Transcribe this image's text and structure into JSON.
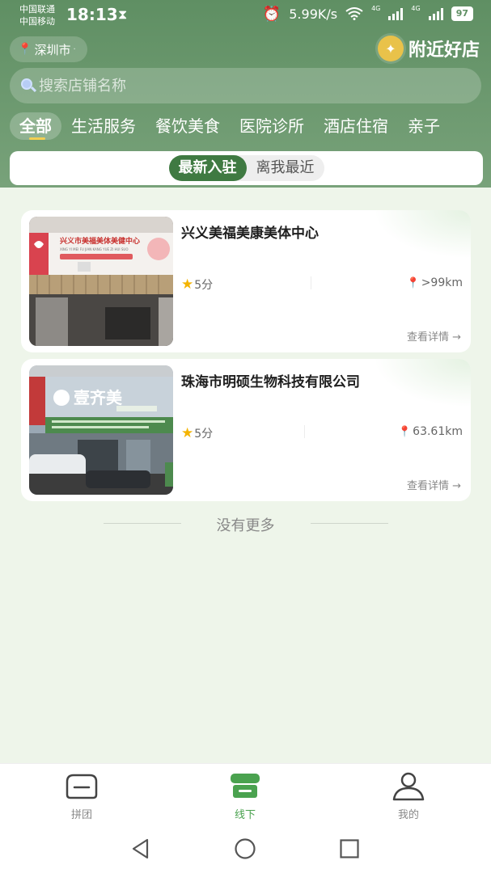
{
  "status_bar": {
    "carrier_1": "中国联通",
    "carrier_2": "中国移动",
    "time": "18:13",
    "speed": "5.99K/s",
    "network_1": "4G",
    "network_2": "4G",
    "battery": "97"
  },
  "header": {
    "location": "深圳市",
    "title": "附近好店",
    "search_placeholder": "搜索店铺名称"
  },
  "category_tabs": [
    {
      "label": "全部",
      "active": true
    },
    {
      "label": "生活服务",
      "active": false
    },
    {
      "label": "餐饮美食",
      "active": false
    },
    {
      "label": "医院诊所",
      "active": false
    },
    {
      "label": "酒店住宿",
      "active": false
    },
    {
      "label": "亲子",
      "active": false
    }
  ],
  "sort": {
    "newest": "最新入驻",
    "nearest": "离我最近",
    "active": "newest"
  },
  "stores": [
    {
      "name": "兴义美福美康美体中心",
      "rating": "5分",
      "distance": ">99km",
      "detail": "查看详情 →",
      "sign_text": "兴义市美福美体美健中心",
      "sign_sub": "XING YI MEI FU JIAN KANG YUE ZI HUI SUO"
    },
    {
      "name": "珠海市明硕生物科技有限公司",
      "rating": "5分",
      "distance": "63.61km",
      "detail": "查看详情 →",
      "sign_text": "壹齐美"
    }
  ],
  "list_end": "没有更多",
  "bottom_nav": [
    {
      "label": "拼团",
      "icon": "group-buy-icon",
      "active": false
    },
    {
      "label": "线下",
      "icon": "offline-store-icon",
      "active": true
    },
    {
      "label": "我的",
      "icon": "profile-icon",
      "active": false
    }
  ],
  "colors": {
    "header_green": "#5f8f63",
    "accent_green": "#3f7a42",
    "nav_active": "#4aa24f",
    "star": "#f4b400",
    "pin": "#e24b3b"
  }
}
